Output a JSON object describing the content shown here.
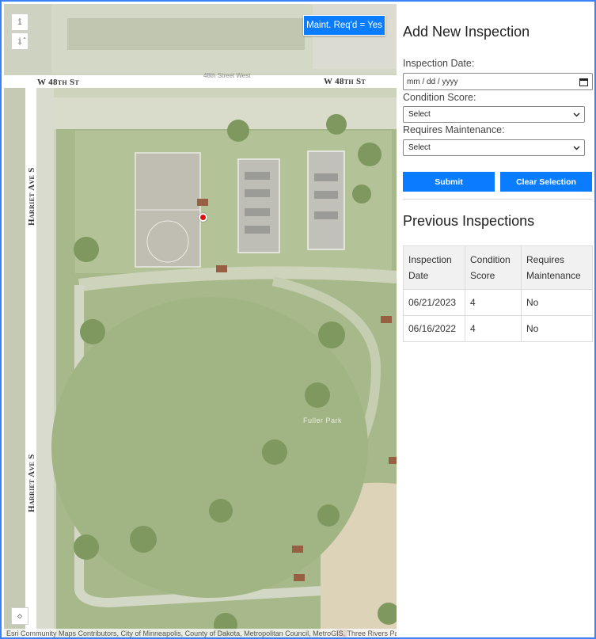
{
  "map": {
    "streets": {
      "w48th_left": "W 48th St",
      "w48th_right": "W 48th St",
      "w48th_faint": "48th Street West",
      "harriet_upper": "Harriet Ave S",
      "harriet_lower": "Harriet Ave S"
    },
    "park_label": "Fuller Park",
    "filter_chip": "Maint. Req'd = Yes",
    "attribution": "Esri Community Maps Contributors, City of Minneapolis, County of Dakota, Metropolitan Council, MetroGIS, Three Rivers Park",
    "controls": {
      "zoom_in_icon": "zoom-in-icon",
      "zoom_out_icon": "zoom-out-icon",
      "compass_icon": "compass-icon"
    },
    "selected_point_color": "#e01010"
  },
  "panel": {
    "title": "Add New Inspection",
    "date_label": "Inspection Date:",
    "date_placeholder": "mm / dd / yyyy",
    "condition_label": "Condition Score:",
    "condition_value": "Select",
    "maintenance_label": "Requires Maintenance:",
    "maintenance_value": "Select",
    "submit_label": "Submit",
    "clear_label": "Clear Selection",
    "accent_color": "#0a7cff"
  },
  "previous": {
    "title": "Previous Inspections",
    "columns": [
      "Inspection Date",
      "Condition Score",
      "Requires Maintenance"
    ],
    "rows": [
      [
        "06/21/2023",
        "4",
        "No"
      ],
      [
        "06/16/2022",
        "4",
        "No"
      ]
    ]
  }
}
